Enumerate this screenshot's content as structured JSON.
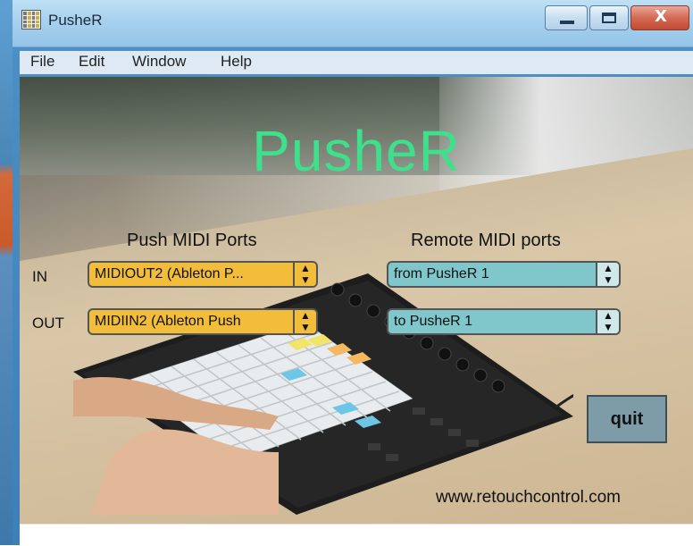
{
  "window": {
    "title": "PusheR"
  },
  "menu": {
    "items": [
      "File",
      "Edit",
      "Window",
      "Help"
    ]
  },
  "app": {
    "title": "PusheR",
    "title_color": "#3ee08c"
  },
  "push_ports": {
    "heading": "Push MIDI Ports",
    "in_label": "IN",
    "out_label": "OUT",
    "in_value": "MIDIOUT2 (Ableton P...",
    "out_value": "MIDIIN2 (Ableton Push",
    "color": "#f2bd3a"
  },
  "remote_ports": {
    "heading": "Remote MIDI ports",
    "in_value": "from PusheR 1",
    "out_value": "to PusheR 1",
    "color": "#7fc7cb"
  },
  "quit_label": "quit",
  "url": "www.retouchcontrol.com",
  "icons": [
    "app-grid-icon",
    "minimize-icon",
    "maximize-icon",
    "close-icon",
    "updown-arrow-icon"
  ]
}
